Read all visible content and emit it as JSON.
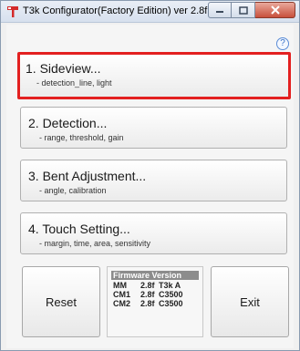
{
  "window": {
    "title": "T3k Configurator(Factory Edition) ver 2.8f"
  },
  "help": {
    "glyph": "?"
  },
  "menu": [
    {
      "title": "1. Sideview...",
      "subtitle": "- detection_line, light",
      "selected": true
    },
    {
      "title": "2. Detection...",
      "subtitle": "- range, threshold, gain",
      "selected": false
    },
    {
      "title": "3. Bent Adjustment...",
      "subtitle": "- angle, calibration",
      "selected": false
    },
    {
      "title": "4. Touch Setting...",
      "subtitle": "- margin, time, area, sensitivity",
      "selected": false
    }
  ],
  "buttons": {
    "reset": "Reset",
    "exit": "Exit"
  },
  "firmware": {
    "header": "Firmware Version",
    "rows": [
      {
        "name": "MM",
        "version": "2.8f",
        "model": "T3k A"
      },
      {
        "name": "CM1",
        "version": "2.8f",
        "model": "C3500"
      },
      {
        "name": "CM2",
        "version": "2.8f",
        "model": "C3500"
      }
    ]
  },
  "colors": {
    "selection_border": "#e32020",
    "titlebar_close": "#c8503c",
    "firmware_header_bg": "#8c8c8c"
  }
}
